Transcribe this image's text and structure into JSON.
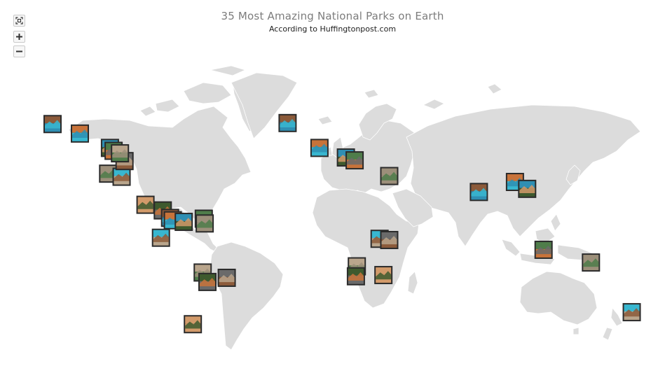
{
  "chart": {
    "title": "35 Most Amazing National Parks on Earth",
    "subtitle": "According to Huffingtonpost.com"
  },
  "controls": [
    {
      "id": "zoom-fit",
      "icon": "fit-to-screen-icon"
    },
    {
      "id": "zoom-in",
      "icon": "plus-icon"
    },
    {
      "id": "zoom-out",
      "icon": "minus-icon"
    }
  ],
  "colors": {
    "land": "#dcdcdc",
    "border": "#ffffff",
    "marker_frame": "#2b2b2b",
    "photo_palette": [
      "#8b5a3a",
      "#c8733a",
      "#2f8fb3",
      "#4f7d4a",
      "#9c8f7a",
      "#38b7d0",
      "#6a6a6a",
      "#b9a58c",
      "#3e5a2e",
      "#d29a6a"
    ]
  },
  "chart_data": {
    "type": "map",
    "map": "world",
    "marker": "photo-thumbnail",
    "points": [
      {
        "lon": -150.0,
        "lat": 63.5
      },
      {
        "lon": -135.0,
        "lat": 58.8
      },
      {
        "lon": -118.5,
        "lat": 51.5
      },
      {
        "lon": -116.5,
        "lat": 50.0
      },
      {
        "lon": -119.5,
        "lat": 37.8
      },
      {
        "lon": -112.1,
        "lat": 36.1
      },
      {
        "lon": -110.5,
        "lat": 44.6
      },
      {
        "lon": -113.0,
        "lat": 48.7
      },
      {
        "lon": -89.5,
        "lat": 16.6
      },
      {
        "lon": -99.0,
        "lat": 20.0
      },
      {
        "lon": -85.5,
        "lat": 12.0
      },
      {
        "lon": -84.0,
        "lat": 10.5
      },
      {
        "lon": -78.0,
        "lat": 9.5
      },
      {
        "lon": -67.0,
        "lat": 11.5
      },
      {
        "lon": -66.5,
        "lat": 8.5
      },
      {
        "lon": -90.5,
        "lat": -0.8
      },
      {
        "lon": -54.4,
        "lat": -25.6
      },
      {
        "lon": -67.6,
        "lat": -22.5
      },
      {
        "lon": -65.0,
        "lat": -28.0
      },
      {
        "lon": -73.0,
        "lat": -51.0
      },
      {
        "lon": -21.0,
        "lat": 64.0
      },
      {
        "lon": -3.5,
        "lat": 51.5
      },
      {
        "lon": 11.0,
        "lat": 46.5
      },
      {
        "lon": 15.8,
        "lat": 45.0
      },
      {
        "lon": 34.8,
        "lat": 36.5
      },
      {
        "lon": 29.5,
        "lat": -1.5
      },
      {
        "lon": 34.8,
        "lat": -2.3
      },
      {
        "lon": 17.0,
        "lat": -18.8
      },
      {
        "lon": 16.5,
        "lat": -24.7
      },
      {
        "lon": 31.6,
        "lat": -24.0
      },
      {
        "lon": 84.0,
        "lat": 27.5
      },
      {
        "lon": 103.8,
        "lat": 33.2
      },
      {
        "lon": 110.5,
        "lat": 29.3
      },
      {
        "lon": 119.5,
        "lat": -8.6
      },
      {
        "lon": 145.5,
        "lat": -16.5
      },
      {
        "lon": 167.9,
        "lat": -44.7
      }
    ]
  }
}
